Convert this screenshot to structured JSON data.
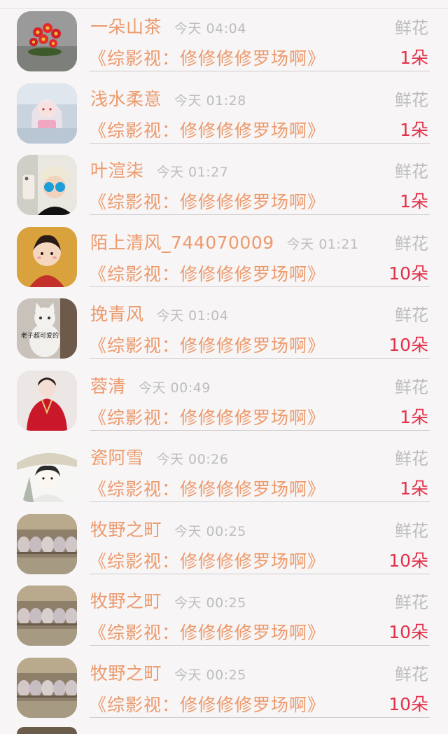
{
  "list": {
    "items": [
      {
        "name": "一朵山茶",
        "time": "今天 04:04",
        "category": "鲜花",
        "book": "《综影视：修修修修罗场啊》",
        "count": "1朵",
        "avatar": "flowers"
      },
      {
        "name": "浅水柔意",
        "time": "今天 01:28",
        "category": "鲜花",
        "book": "《综影视：修修修修罗场啊》",
        "count": "1朵",
        "avatar": "anime-girl"
      },
      {
        "name": "叶渲柒",
        "time": "今天 01:27",
        "category": "鲜花",
        "book": "《综影视：修修修修罗场啊》",
        "count": "1朵",
        "avatar": "selfie"
      },
      {
        "name": "陌上清风_744070009",
        "time": "今天 01:21",
        "category": "鲜花",
        "book": "《综影视：修修修修罗场啊》",
        "count": "10朵",
        "avatar": "cartoon"
      },
      {
        "name": "挽青风",
        "time": "今天 01:04",
        "category": "鲜花",
        "book": "《综影视：修修修修罗场啊》",
        "count": "10朵",
        "avatar": "cat",
        "avatar_caption": "老子超可爱的"
      },
      {
        "name": "蓉清",
        "time": "今天 00:49",
        "category": "鲜花",
        "book": "《综影视：修修修修罗场啊》",
        "count": "1朵",
        "avatar": "hanfu"
      },
      {
        "name": "瓷阿雪",
        "time": "今天 00:26",
        "category": "鲜花",
        "book": "《综影视：修修修修罗场啊》",
        "count": "1朵",
        "avatar": "sketch"
      },
      {
        "name": "牧野之町",
        "time": "今天 00:25",
        "category": "鲜花",
        "book": "《综影视：修修修修罗场啊》",
        "count": "10朵",
        "avatar": "cats-row"
      },
      {
        "name": "牧野之町",
        "time": "今天 00:25",
        "category": "鲜花",
        "book": "《综影视：修修修修罗场啊》",
        "count": "10朵",
        "avatar": "cats-row"
      },
      {
        "name": "牧野之町",
        "time": "今天 00:25",
        "category": "鲜花",
        "book": "《综影视：修修修修罗场啊》",
        "count": "10朵",
        "avatar": "cats-row"
      }
    ]
  },
  "colors": {
    "accent": "#ec9a6c",
    "count": "#e2324b",
    "muted": "#bdbdbd",
    "background": "#f7f5f6"
  }
}
